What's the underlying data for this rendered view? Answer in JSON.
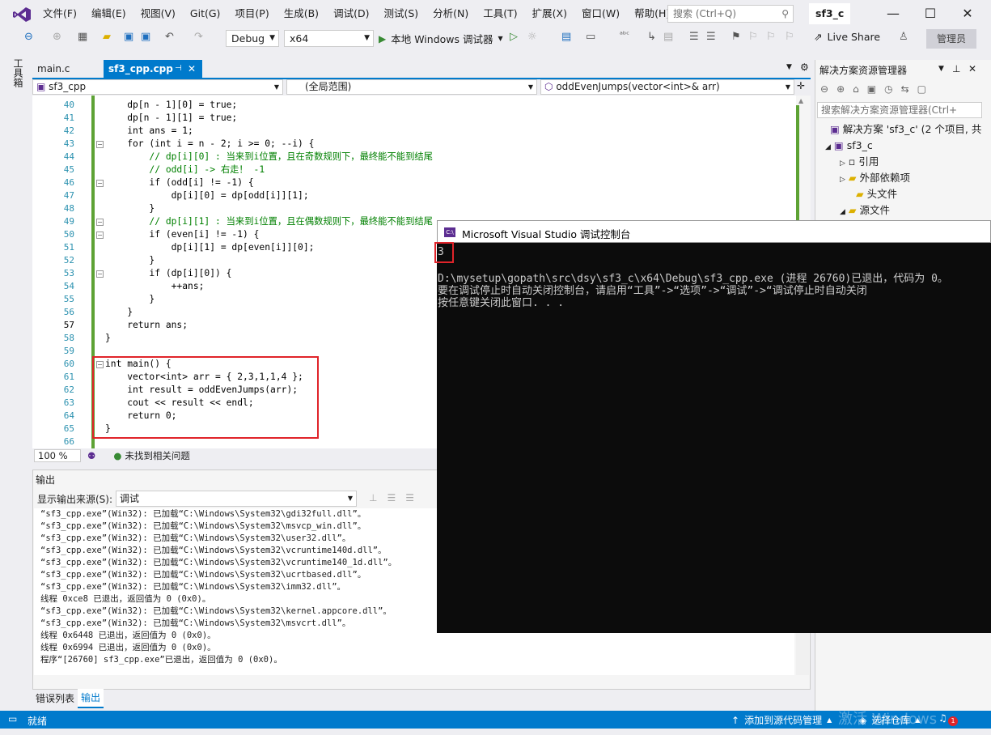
{
  "menu": [
    "文件(F)",
    "编辑(E)",
    "视图(V)",
    "Git(G)",
    "项目(P)",
    "生成(B)",
    "调试(D)",
    "测试(S)",
    "分析(N)",
    "工具(T)",
    "扩展(X)",
    "窗口(W)",
    "帮助(H)"
  ],
  "search_placeholder": "搜索 (Ctrl+Q)",
  "solution_badge": "sf3_c",
  "toolbar": {
    "config": "Debug",
    "platform": "x64",
    "run_label": "本地 Windows 调试器",
    "live_share": "Live Share",
    "admin": "管理员"
  },
  "toolbox_label": "工具箱",
  "tabs": [
    {
      "label": "main.c"
    },
    {
      "label": "sf3_cpp.cpp"
    }
  ],
  "nav": {
    "project": "sf3_cpp",
    "scope": "(全局范围)",
    "member": "oddEvenJumps(vector<int>& arr)"
  },
  "editor": {
    "line_numbers": [
      "40",
      "41",
      "42",
      "43",
      "44",
      "45",
      "46",
      "47",
      "48",
      "49",
      "50",
      "51",
      "52",
      "53",
      "54",
      "55",
      "56",
      "57",
      "58",
      "59",
      "60",
      "61",
      "62",
      "63",
      "64",
      "65",
      "66"
    ],
    "lines": [
      "    dp[n - 1][0] = true;",
      "    dp[n - 1][1] = true;",
      "    int ans = 1;",
      "    for (int i = n - 2; i >= 0; --i) {",
      "        // dp[i][0] : 当来到i位置，且在奇数规则下，最终能不能到结尾",
      "        // odd[i] -> 右走！ -1",
      "        if (odd[i] != -1) {",
      "            dp[i][0] = dp[odd[i]][1];",
      "        }",
      "        // dp[i][1] : 当来到i位置，且在偶数规则下，最终能不能到结尾",
      "        if (even[i] != -1) {",
      "            dp[i][1] = dp[even[i]][0];",
      "        }",
      "        if (dp[i][0]) {",
      "            ++ans;",
      "        }",
      "    }",
      "    return ans;",
      "}",
      "",
      "int main() {",
      "    vector<int> arr = { 2,3,1,1,4 };",
      "    int result = oddEvenJumps(arr);",
      "    cout << result << endl;",
      "    return 0;",
      "}",
      ""
    ]
  },
  "zoom": "100 %",
  "issues": "未找到相关问题",
  "solution_explorer": {
    "title": "解决方案资源管理器",
    "search_placeholder": "搜索解决方案资源管理器(Ctrl+",
    "items": [
      "解决方案 'sf3_c' (2 个项目, 共",
      "sf3_c",
      "引用",
      "外部依赖项",
      "头文件",
      "源文件"
    ]
  },
  "output": {
    "title": "输出",
    "source_label": "显示输出来源(S):",
    "source_value": "调试",
    "lines": [
      "“sf3_cpp.exe”(Win32): 已加载“C:\\Windows\\System32\\gdi32full.dll”。",
      "“sf3_cpp.exe”(Win32): 已加载“C:\\Windows\\System32\\msvcp_win.dll”。",
      "“sf3_cpp.exe”(Win32): 已加载“C:\\Windows\\System32\\user32.dll”。",
      "“sf3_cpp.exe”(Win32): 已加载“C:\\Windows\\System32\\vcruntime140d.dll”。",
      "“sf3_cpp.exe”(Win32): 已加载“C:\\Windows\\System32\\vcruntime140_1d.dll”。",
      "“sf3_cpp.exe”(Win32): 已加载“C:\\Windows\\System32\\ucrtbased.dll”。",
      "“sf3_cpp.exe”(Win32): 已加载“C:\\Windows\\System32\\imm32.dll”。",
      "线程 0xce8 已退出，返回值为 0 (0x0)。",
      "“sf3_cpp.exe”(Win32): 已加载“C:\\Windows\\System32\\kernel.appcore.dll”。",
      "“sf3_cpp.exe”(Win32): 已加载“C:\\Windows\\System32\\msvcrt.dll”。",
      "线程 0x6448 已退出，返回值为 0 (0x0)。",
      "线程 0x6994 已退出，返回值为 0 (0x0)。",
      "程序“[26760] sf3_cpp.exe”已退出，返回值为 0 (0x0)。"
    ],
    "tabs": [
      "错误列表",
      "输出"
    ]
  },
  "console": {
    "title": "Microsoft Visual Studio 调试控制台",
    "result": "3",
    "lines": [
      "D:\\mysetup\\gopath\\src\\dsy\\sf3_c\\x64\\Debug\\sf3_cpp.exe (进程 26760)已退出，代码为 0。",
      "要在调试停止时自动关闭控制台，请启用“工具”->“选项”->“调试”->“调试停止时自动关闭",
      "按任意键关闭此窗口. . ."
    ]
  },
  "status": {
    "ready": "就绪",
    "source_control": "添加到源代码管理",
    "repo": "选择仓库",
    "notifications": "1",
    "watermark": "激活 Windows"
  },
  "colors": {
    "accent": "#007acc",
    "green_change": "#5da234",
    "highlight_box": "#e0242a",
    "console_bg": "#0c0c0c"
  }
}
